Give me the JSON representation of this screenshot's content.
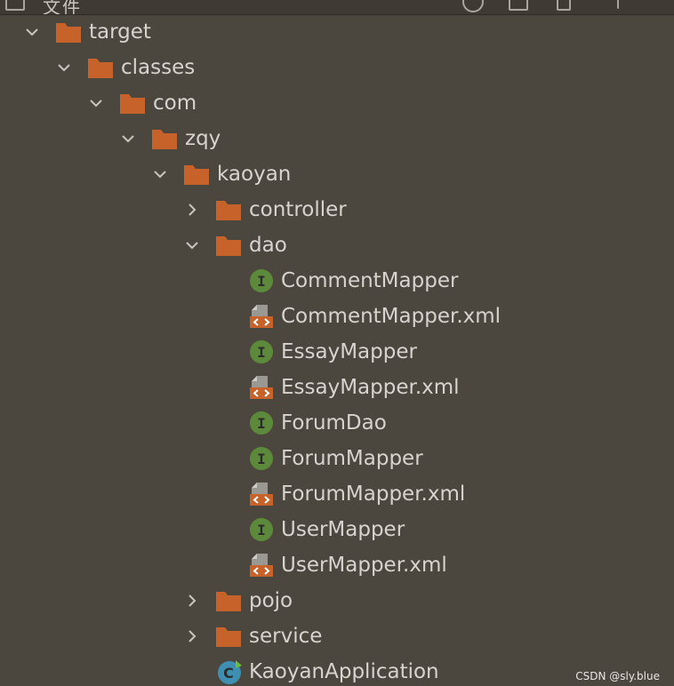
{
  "window": {
    "header_fragment": "文件"
  },
  "tree": {
    "items": [
      {
        "label": "target",
        "type": "folder",
        "state": "expanded",
        "depth": 0
      },
      {
        "label": "classes",
        "type": "folder",
        "state": "expanded",
        "depth": 1
      },
      {
        "label": "com",
        "type": "folder",
        "state": "expanded",
        "depth": 2
      },
      {
        "label": "zqy",
        "type": "folder",
        "state": "expanded",
        "depth": 3
      },
      {
        "label": "kaoyan",
        "type": "folder",
        "state": "expanded",
        "depth": 4
      },
      {
        "label": "controller",
        "type": "folder",
        "state": "collapsed",
        "depth": 5
      },
      {
        "label": "dao",
        "type": "folder",
        "state": "expanded",
        "depth": 5
      },
      {
        "label": "CommentMapper",
        "type": "interface",
        "depth": 6
      },
      {
        "label": "CommentMapper.xml",
        "type": "xml",
        "depth": 6
      },
      {
        "label": "EssayMapper",
        "type": "interface",
        "depth": 6
      },
      {
        "label": "EssayMapper.xml",
        "type": "xml",
        "depth": 6
      },
      {
        "label": "ForumDao",
        "type": "interface",
        "depth": 6
      },
      {
        "label": "ForumMapper",
        "type": "interface",
        "depth": 6
      },
      {
        "label": "ForumMapper.xml",
        "type": "xml",
        "depth": 6
      },
      {
        "label": "UserMapper",
        "type": "interface",
        "depth": 6
      },
      {
        "label": "UserMapper.xml",
        "type": "xml",
        "depth": 6
      },
      {
        "label": "pojo",
        "type": "folder",
        "state": "collapsed",
        "depth": 5
      },
      {
        "label": "service",
        "type": "folder",
        "state": "collapsed",
        "depth": 5
      },
      {
        "label": "KaoyanApplication",
        "type": "spring-class",
        "depth": 5
      }
    ]
  },
  "icons": {
    "folder": "folder-icon",
    "interface": "interface-icon",
    "xml": "xml-file-icon",
    "spring-class": "spring-boot-class-icon",
    "expanded": "chevron-down-icon",
    "collapsed": "chevron-right-icon"
  },
  "colors": {
    "background": "#4b473e",
    "folder": "#c7622b",
    "interface_badge": "#5d8a3a",
    "xml_badge": "#c7622b",
    "class_badge": "#3f8fb3",
    "text": "#d7d4cf"
  },
  "watermark": {
    "text": "CSDN @sly.blue"
  }
}
